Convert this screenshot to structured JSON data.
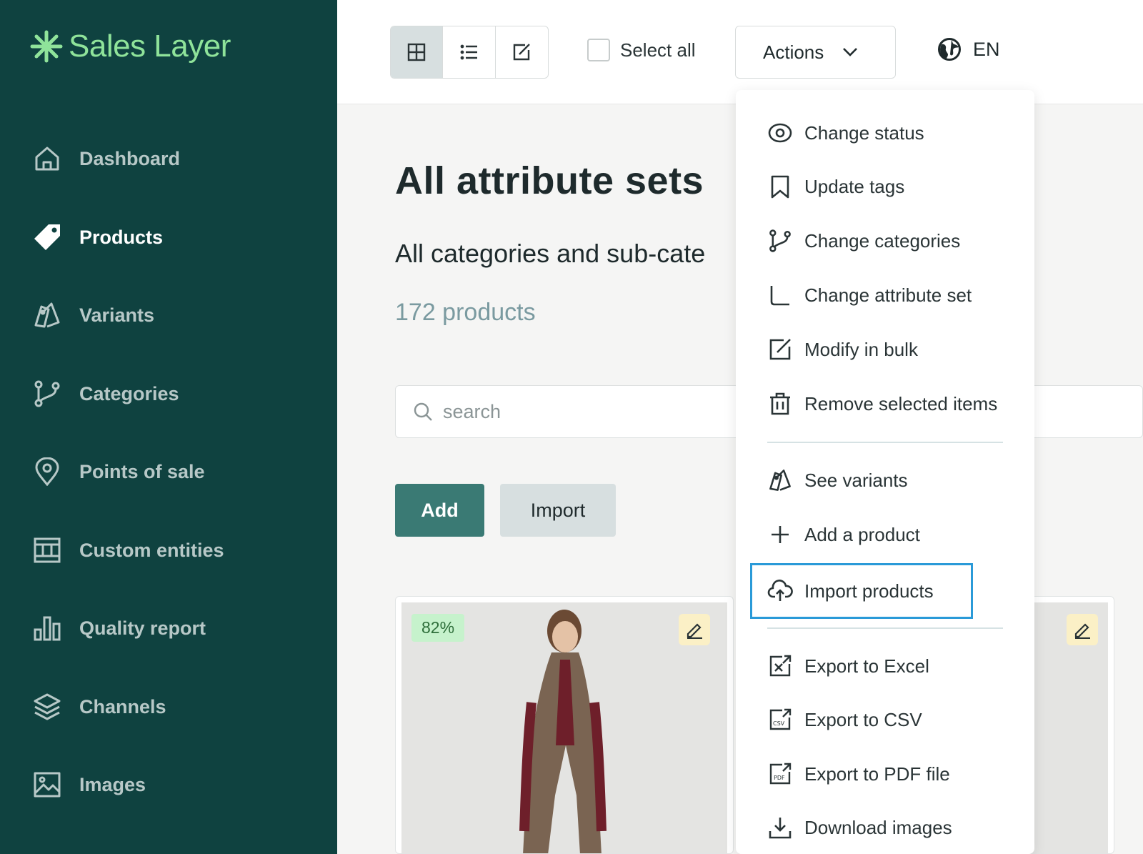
{
  "sidebar": {
    "logo": "Sales Layer",
    "items": [
      {
        "label": "Dashboard",
        "icon": "home-icon"
      },
      {
        "label": "Products",
        "icon": "tag-icon"
      },
      {
        "label": "Variants",
        "icon": "variants-icon"
      },
      {
        "label": "Categories",
        "icon": "branch-icon"
      },
      {
        "label": "Points of sale",
        "icon": "location-pin-icon"
      },
      {
        "label": "Custom entities",
        "icon": "table-icon"
      },
      {
        "label": "Quality report",
        "icon": "bar-chart-icon"
      },
      {
        "label": "Channels",
        "icon": "layers-icon"
      },
      {
        "label": "Images",
        "icon": "image-icon"
      }
    ],
    "active_item": "Products"
  },
  "topbar": {
    "view_modes": [
      "grid",
      "list",
      "edit"
    ],
    "active_view": "grid",
    "select_all_label": "Select all",
    "actions_label": "Actions",
    "language": "EN"
  },
  "main": {
    "title": "All attribute sets",
    "subtitle": "All categories and sub-cate",
    "count": "172 products",
    "search_placeholder": "search",
    "add_label": "Add",
    "import_label": "Import"
  },
  "cards": [
    {
      "quality": "82%"
    }
  ],
  "actions_menu": {
    "items": [
      {
        "label": "Change status",
        "icon": "eye-icon"
      },
      {
        "label": "Update tags",
        "icon": "bookmark-icon"
      },
      {
        "label": "Change categories",
        "icon": "branch-icon"
      },
      {
        "label": "Change attribute set",
        "icon": "corner-icon"
      },
      {
        "label": "Modify in bulk",
        "icon": "edit-square-icon"
      },
      {
        "label": "Remove selected items",
        "icon": "trash-icon"
      },
      {
        "label": "See variants",
        "icon": "variants-icon"
      },
      {
        "label": "Add a product",
        "icon": "plus-icon"
      },
      {
        "label": "Import products",
        "icon": "cloud-upload-icon"
      },
      {
        "label": "Export to Excel",
        "icon": "excel-export-icon"
      },
      {
        "label": "Export to CSV",
        "icon": "csv-export-icon"
      },
      {
        "label": "Export to PDF file",
        "icon": "pdf-export-icon"
      },
      {
        "label": "Download images",
        "icon": "download-icon"
      }
    ],
    "highlighted": "Import products"
  },
  "colors": {
    "sidebar_bg": "#0f4240",
    "logo_green": "#8fe39a",
    "primary_button": "#3a7a74",
    "secondary_button": "#d7dfe0",
    "highlight_border": "#2a9ad8",
    "quality_badge_bg": "#c6f2cc"
  }
}
